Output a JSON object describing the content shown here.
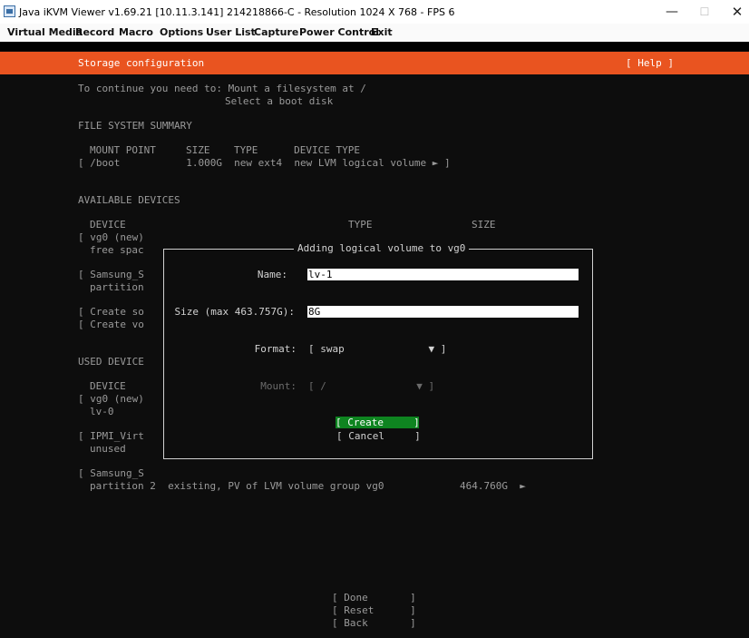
{
  "window": {
    "title": "Java iKVM Viewer v1.69.21 [10.11.3.141] 214218866-C - Resolution 1024 X 768 - FPS 6",
    "minimize": "—",
    "maximize": "☐",
    "close": "✕"
  },
  "menu": [
    "Virtual Media",
    "Record",
    "Macro",
    "Options",
    "User List",
    "Capture",
    "Power Control",
    "Exit"
  ],
  "colors": {
    "header": "#e95420",
    "create_button": "#0e8420",
    "screen_bg": "#0d0d0d"
  },
  "installer": {
    "header_title": "Storage configuration",
    "help": "[ Help ]",
    "intro_line1": "To continue you need to: Mount a filesystem at /",
    "intro_line2": "Select a boot disk",
    "fs_summary_title": "FILE SYSTEM SUMMARY",
    "fs_header": "MOUNT POINT     SIZE    TYPE      DEVICE TYPE",
    "fs_row": "[ /boot           1.000G  new ext4  new LVM logical volume ► ]",
    "available_title": "AVAILABLE DEVICES",
    "avail_device_header": "DEVICE",
    "avail_type_header": "TYPE",
    "avail_size_header": "SIZE",
    "avail_vg0": "[ vg0 (new)",
    "avail_free": "free spac",
    "avail_samsung": "[ Samsung_S",
    "avail_partition": "partition",
    "create_so": "[ Create so",
    "create_vo": "[ Create vo",
    "used_title": "USED DEVICE",
    "used_device_header": "DEVICE",
    "used_vg0": "[ vg0 (new)",
    "used_lv0": "lv-0",
    "used_ipmi": "[ IPMI_Virt",
    "used_unused": "unused",
    "used_samsung": "[ Samsung_S",
    "used_partition2": "partition 2  existing, PV of LVM volume group vg0",
    "used_partition2_size": "464.760G  ►",
    "done": "[ Done       ]",
    "reset": "[ Reset      ]",
    "back": "[ Back       ]"
  },
  "dialog": {
    "title": "Adding logical volume to vg0",
    "name_label": "Name:",
    "name_value": "lv-1",
    "size_label": "Size (max 463.757G):",
    "size_value": "8G",
    "format_label": "Format:",
    "format_value": "[ swap              ▼ ]",
    "mount_label": "Mount:",
    "mount_value": "[ /               ▼ ]",
    "create": "[ Create     ]",
    "cancel": "[ Cancel     ]"
  }
}
